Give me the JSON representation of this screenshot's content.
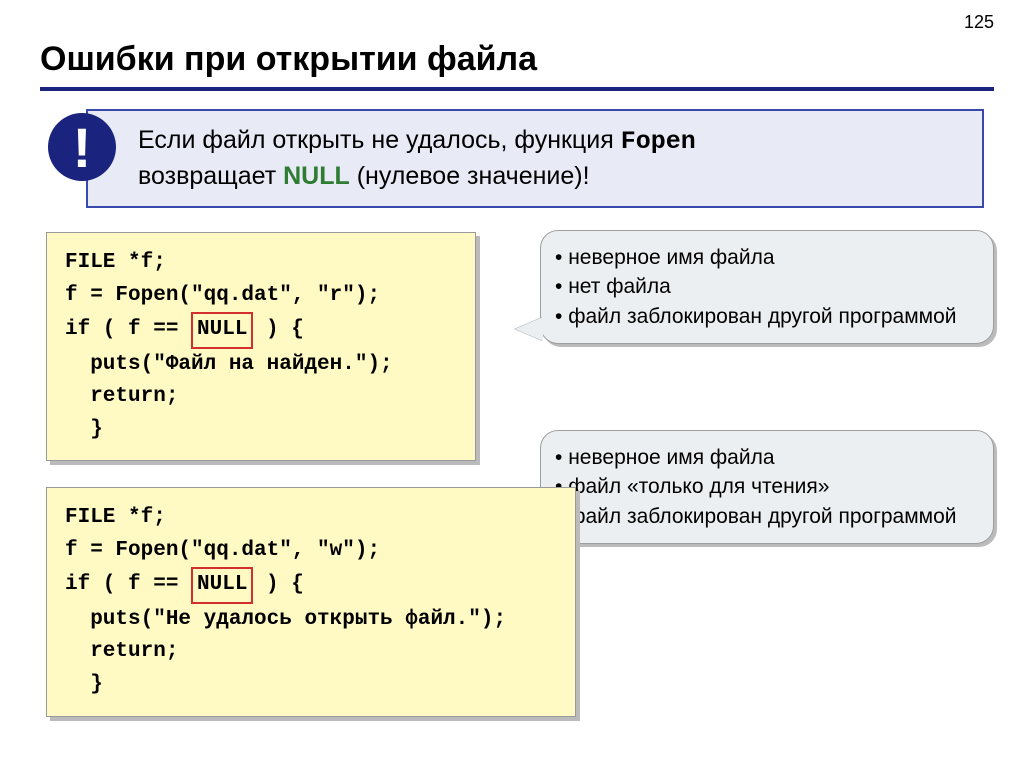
{
  "page_number": "125",
  "title": "Ошибки при открытии файла",
  "alert": {
    "icon": "!",
    "text_before": "Если файл открыть не удалось, функция ",
    "fopen": "Fopen",
    "text_mid": " возвращает ",
    "null_word": "NULL",
    "text_after": " (нулевое значение)!"
  },
  "code1": {
    "l1": "FILE *f;",
    "l2": "f = Fopen(\"qq.dat\", \"r\");",
    "l3_a": "if ( f == ",
    "l3_null": "NULL",
    "l3_b": " ) {",
    "l4": "  puts(\"Файл на найден.\");",
    "l5": "  return;",
    "l6": "  }"
  },
  "code2": {
    "l1": "FILE *f;",
    "l2": "f = Fopen(\"qq.dat\", \"w\");",
    "l3_a": "if ( f == ",
    "l3_null": "NULL",
    "l3_b": " ) {",
    "l4": "  puts(\"Не удалось открыть файл.\");",
    "l5": "  return;",
    "l6": "  }"
  },
  "callout1": {
    "items": [
      "неверное имя файла",
      "нет файла",
      "файл заблокирован другой программой"
    ]
  },
  "callout2": {
    "items": [
      "неверное имя файла",
      "файл «только для чтения»",
      "файл заблокирован другой программой"
    ]
  }
}
